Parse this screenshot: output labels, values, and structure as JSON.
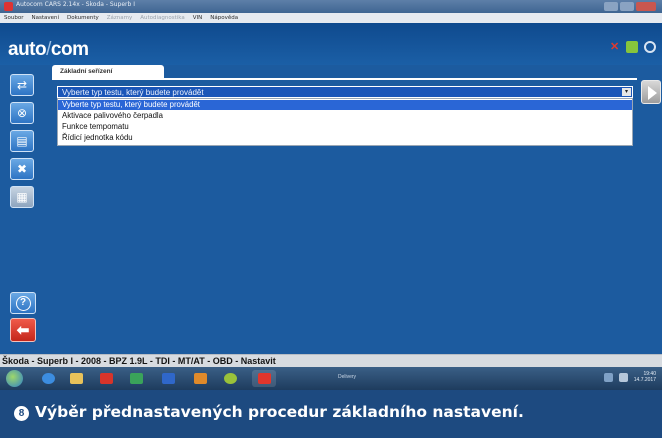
{
  "window": {
    "title": "Autocom CARS 2.14x - Skoda - Superb I",
    "menu": [
      {
        "label": "Soubor",
        "enabled": true
      },
      {
        "label": "Nastavení",
        "enabled": true
      },
      {
        "label": "Dokumenty",
        "enabled": true
      },
      {
        "label": "Záznamy",
        "enabled": false
      },
      {
        "label": "Autodiagnostika",
        "enabled": false
      },
      {
        "label": "VIN",
        "enabled": true
      },
      {
        "label": "Nápověda",
        "enabled": true
      }
    ]
  },
  "app": {
    "logo_left": "auto",
    "logo_slash": "/",
    "logo_right": "com"
  },
  "panel": {
    "tab_label": "Základní seřízení"
  },
  "dropdown": {
    "selected": "Vyberte typ testu, který budete provádět",
    "options": [
      {
        "label": "Vyberte typ testu, který budete provádět",
        "selected": true
      },
      {
        "label": "Aktivace palivového čerpadla",
        "selected": false
      },
      {
        "label": "Funkce tempomatu",
        "selected": false
      },
      {
        "label": "Řídicí jednotka kódu",
        "selected": false
      }
    ]
  },
  "status_bar": {
    "vehicle": "Škoda - Superb I - 2008 - BPZ 1.9L - TDI - MT/AT - OBD - Nastavit"
  },
  "taskbar": {
    "label": "Delivery",
    "clock_time": "19:40",
    "clock_date": "14.7.2017"
  },
  "caption": {
    "number": "8",
    "text": "Výběr přednastavených procedur základního nastavení."
  },
  "colors": {
    "screen_blue": "#1c5b9f",
    "selection_blue": "#2a66d6",
    "back_red": "#c4261b",
    "caption_band": "#1d4a80"
  },
  "icons": {
    "sidebar": [
      "vehicle-select-icon",
      "diagnostics-icon",
      "document-icon",
      "close-x-icon",
      "data-grid-icon"
    ],
    "help": "help-icon",
    "back": "back-arrow-icon",
    "next": "next-arrow-icon"
  }
}
